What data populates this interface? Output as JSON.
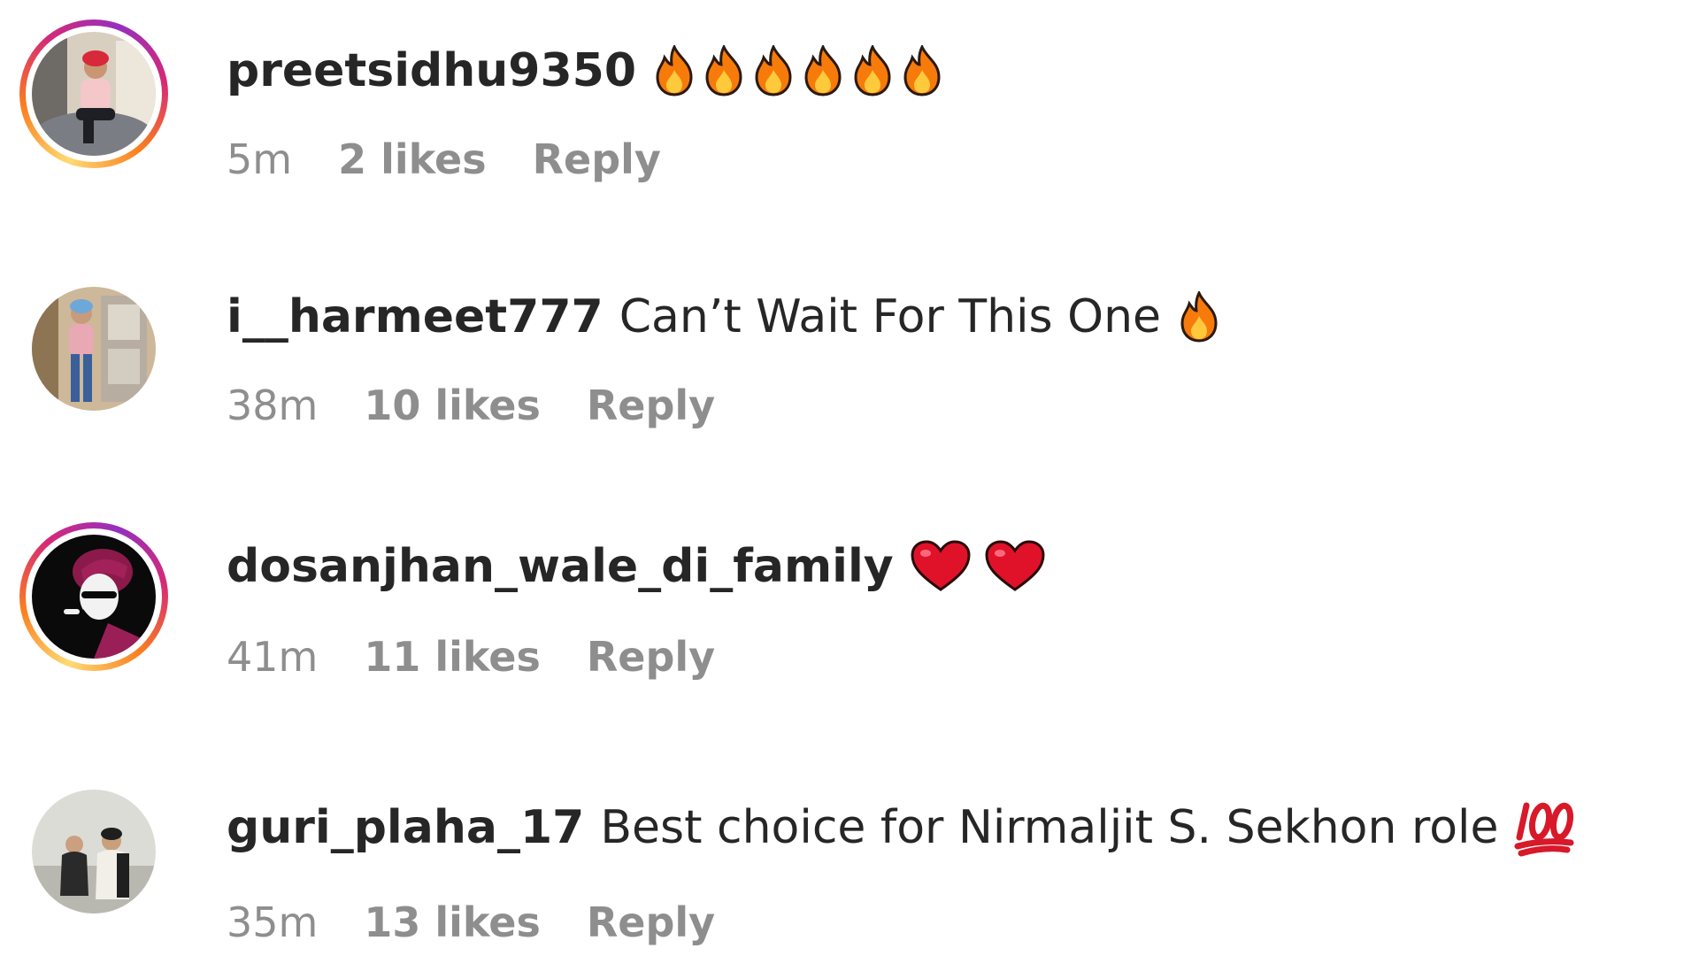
{
  "comments": [
    {
      "username": "preetsidhu9350",
      "text": "",
      "emoji": "fire-icon",
      "emoji_count": 6,
      "time": "5m",
      "likes": "2 likes",
      "reply": "Reply",
      "has_story": true
    },
    {
      "username": "i__harmeet777",
      "text": "Can’t Wait For This One",
      "emoji": "fire-icon",
      "emoji_count": 1,
      "time": "38m",
      "likes": "10 likes",
      "reply": "Reply",
      "has_story": false
    },
    {
      "username": "dosanjhan_wale_di_family",
      "text": "",
      "emoji": "red-heart-icon",
      "emoji_count": 2,
      "time": "41m",
      "likes": "11 likes",
      "reply": "Reply",
      "has_story": true
    },
    {
      "username": "guri_plaha_17",
      "text": "Best choice for Nirmaljit S. Sekhon role",
      "emoji": "hundred-points-icon",
      "emoji_count": 1,
      "time": "35m",
      "likes": "13 likes",
      "reply": "Reply",
      "has_story": false
    }
  ],
  "colors": {
    "text": "#262626",
    "meta": "#8e8e8e",
    "fire_outer": "#f77b0a",
    "fire_inner": "#ffc93c",
    "heart": "#e0122a",
    "hundred": "#d7192a"
  }
}
